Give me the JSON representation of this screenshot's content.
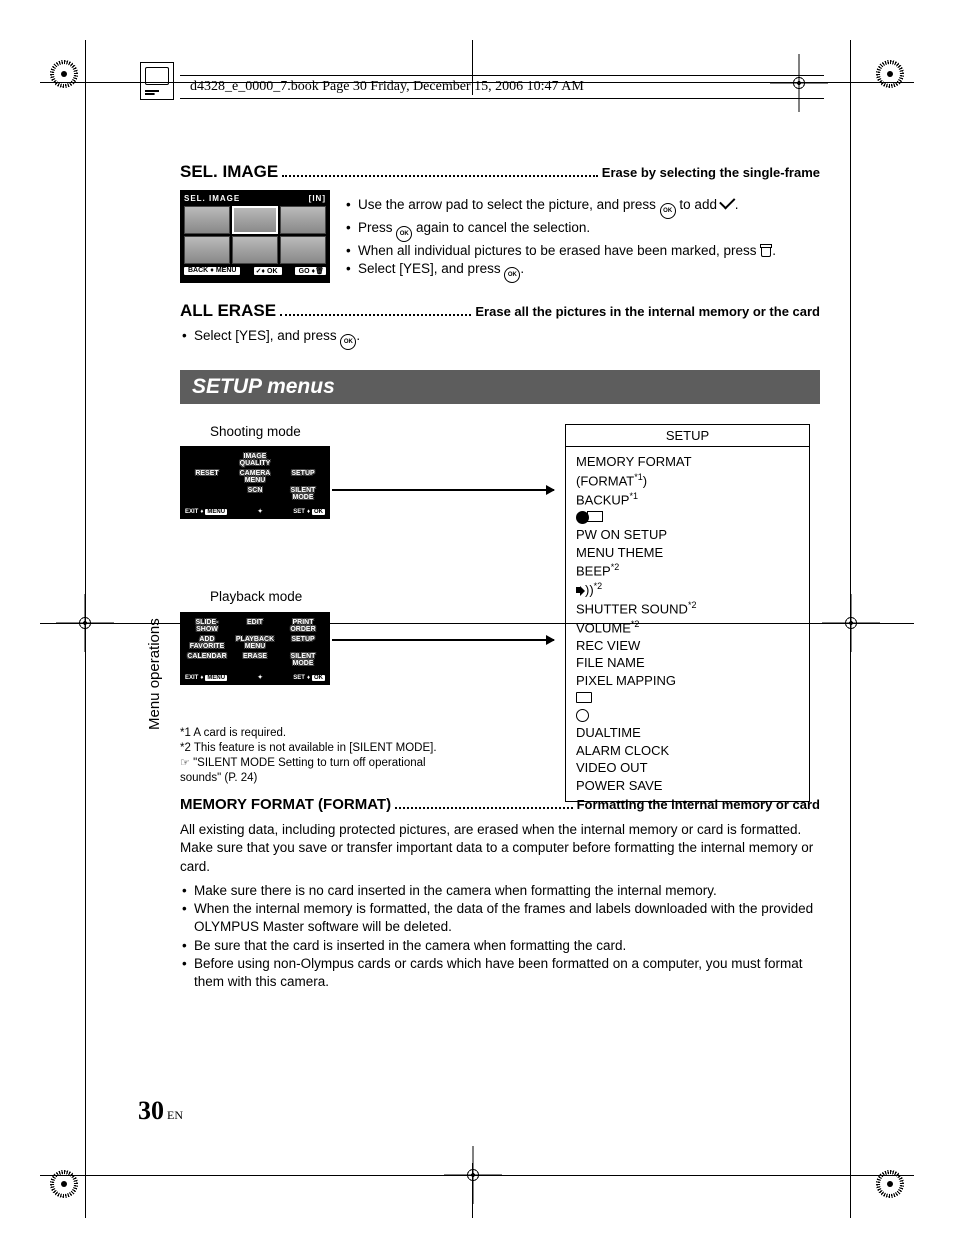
{
  "header": {
    "text": "d4328_e_0000_7.book  Page 30  Friday, December 15, 2006  10:47 AM"
  },
  "sel_image": {
    "title": "SEL. IMAGE",
    "desc": "Erase by selecting the single-frame",
    "lcd": {
      "title": "SEL. IMAGE",
      "in": "IN",
      "back": "BACK",
      "menu": "MENU",
      "ok": "OK",
      "go": "GO"
    },
    "b1a": "Use the arrow pad to select the picture, and press ",
    "b1b": " to add ",
    "b1c": ".",
    "b2a": "Press ",
    "b2b": " again to cancel the selection.",
    "b3a": "When all individual pictures to be erased have been marked, press ",
    "b3b": ".",
    "b4a": "Select [YES], and press ",
    "b4b": "."
  },
  "all_erase": {
    "title": "ALL ERASE",
    "desc": "Erase all the pictures in the internal memory or the card",
    "b1a": "Select [YES], and press ",
    "b1b": "."
  },
  "setup_bar": "SETUP menus",
  "diagram": {
    "shoot_label": "Shooting mode",
    "play_label": "Playback mode",
    "shoot_cells": [
      "",
      "IMAGE QUALITY",
      "",
      "RESET",
      "CAMERA MENU",
      "SETUP",
      "",
      "SCN",
      "SILENT MODE"
    ],
    "play_cells": [
      "SLIDE- SHOW",
      "EDIT",
      "PRINT ORDER",
      "ADD FAVORITE",
      "PLAYBACK MENU",
      "SETUP",
      "CALENDAR",
      "ERASE",
      "SILENT MODE"
    ],
    "foot_exit": "EXIT",
    "foot_menu": "MENU",
    "foot_set": "SET",
    "foot_ok": "OK",
    "setup_title": "SETUP",
    "setup_items": {
      "l1": "MEMORY FORMAT",
      "l2a": "(FORMAT",
      "l2b": ")",
      "l3": "BACKUP",
      "l5": "PW ON SETUP",
      "l6": "MENU THEME",
      "l7": "BEEP",
      "l9": "SHUTTER SOUND",
      "l10": "VOLUME",
      "l11": "REC VIEW",
      "l12": "FILE NAME",
      "l13": "PIXEL MAPPING",
      "l16": "DUALTIME",
      "l17": "ALARM CLOCK",
      "l18": "VIDEO OUT",
      "l19": "POWER SAVE"
    },
    "sup1": "*1",
    "sup2": "*2"
  },
  "footnotes": {
    "n1": "*1 A card is required.",
    "n2": "*2 This feature is not available in [SILENT MODE].",
    "ref": "☞",
    "n3": "\"SILENT MODE Setting to turn off operational sounds\" (P. 24)"
  },
  "memory_format": {
    "title": "MEMORY FORMAT (FORMAT)",
    "desc": "Formatting the internal memory or card",
    "p1": "All existing data, including protected pictures, are erased when the internal memory or card is formatted. Make sure that you save or transfer important data to a computer before formatting the internal memory or card.",
    "b1": "Make sure there is no card inserted in the camera when formatting the internal memory.",
    "b2": "When the internal memory is formatted, the data of the frames and labels downloaded with the provided OLYMPUS Master software will be deleted.",
    "b3": "Be sure that the card is inserted in the camera when formatting the card.",
    "b4": "Before using non-Olympus cards or cards which have been formatted on a computer, you must format them with this camera."
  },
  "side_text": "Menu operations",
  "page": {
    "num": "30",
    "lang": "EN"
  },
  "ok_label": "OK"
}
